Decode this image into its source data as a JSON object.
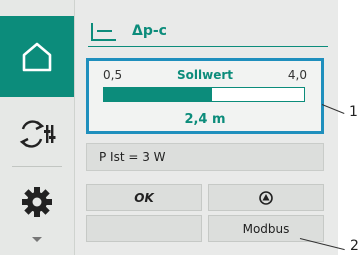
{
  "header": {
    "title": "Δp-c",
    "mode_icon": "control-mode-icon"
  },
  "setpoint": {
    "min": "0,5",
    "label": "Sollwert",
    "max": "4,0",
    "value": "2,4 m",
    "fill_fraction": 0.54
  },
  "info": {
    "power": "P Ist = 3 W"
  },
  "buttons": {
    "ok": "OK",
    "empty": "",
    "status_icon": "pump-icon",
    "modbus": "Modbus"
  },
  "sidebar": {
    "items": [
      "home-icon",
      "settings-sync-icon",
      "gear-icon",
      "chevron-down-icon"
    ]
  },
  "callouts": {
    "c1": "1",
    "c2": "2"
  },
  "colors": {
    "accent": "#0c8c7b",
    "selected_border": "#1f8fbd"
  }
}
